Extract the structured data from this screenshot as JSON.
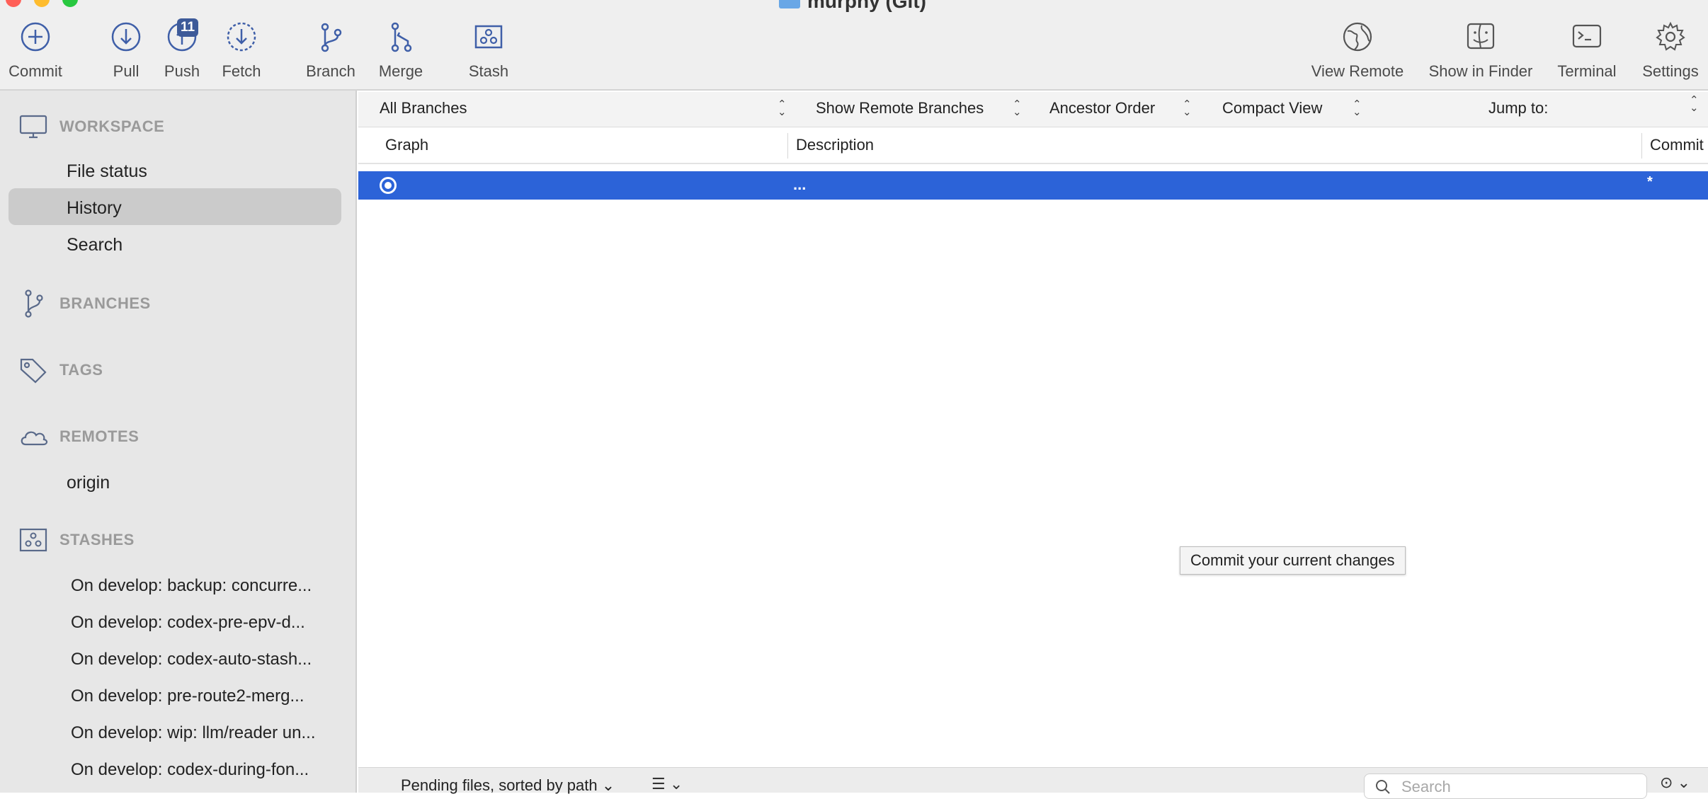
{
  "window": {
    "title": "murphy (Git)"
  },
  "toolbar": {
    "left": [
      {
        "label": "Commit",
        "icon": "plus-circle-icon"
      },
      {
        "label": "Pull",
        "icon": "arrow-down-circle-icon"
      },
      {
        "label": "Push",
        "icon": "arrow-up-circle-icon",
        "badge": "11"
      },
      {
        "label": "Fetch",
        "icon": "dashed-arrow-down-circle-icon"
      },
      {
        "label": "Branch",
        "icon": "branch-icon"
      },
      {
        "label": "Merge",
        "icon": "merge-icon"
      },
      {
        "label": "Stash",
        "icon": "stash-icon"
      }
    ],
    "right": [
      {
        "label": "View Remote",
        "icon": "globe-icon"
      },
      {
        "label": "Show in Finder",
        "icon": "finder-icon"
      },
      {
        "label": "Terminal",
        "icon": "terminal-icon"
      },
      {
        "label": "Settings",
        "icon": "gear-icon"
      }
    ]
  },
  "sidebar": {
    "workspace": {
      "title": "WORKSPACE",
      "items": [
        "File status",
        "History",
        "Search"
      ],
      "selected": "History"
    },
    "branches": {
      "title": "BRANCHES"
    },
    "tags": {
      "title": "TAGS"
    },
    "remotes": {
      "title": "REMOTES",
      "items": [
        "origin"
      ]
    },
    "stashes": {
      "title": "STASHES",
      "items": [
        "On develop: backup: concurre...",
        "On develop: codex-pre-epv-d...",
        "On develop: codex-auto-stash...",
        "On develop: pre-route2-merg...",
        "On develop: wip: llm/reader un...",
        "On develop: codex-during-fon..."
      ]
    }
  },
  "filters": {
    "branches": "All Branches",
    "remote": "Show Remote Branches",
    "order": "Ancestor Order",
    "view": "Compact View",
    "jump": "Jump to:"
  },
  "columns": {
    "graph": "Graph",
    "description": "Description",
    "commit": "Commit"
  },
  "history_row": {
    "description": "...",
    "commit": "*",
    "selected_color": "#2c63d8"
  },
  "tooltip": {
    "text": "Commit your current changes"
  },
  "bottom": {
    "pending": "Pending files, sorted by path",
    "search_placeholder": "Search"
  },
  "colors": {
    "accent": "#2c63d8",
    "badge": "#3d5a99",
    "icon": "#3f5fa8",
    "sidebar_bg": "#e7e7e7",
    "toolbar_bg": "#efefef"
  }
}
